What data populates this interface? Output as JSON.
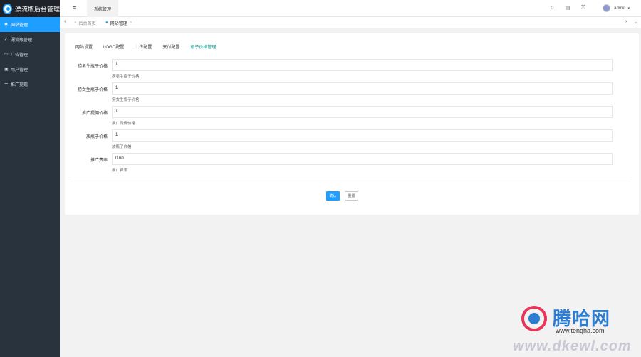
{
  "app": {
    "title": "漂流瓶后台管理"
  },
  "sidebar": {
    "items": [
      {
        "label": "网站管理",
        "icon": "gear-icon",
        "glyph": "✱"
      },
      {
        "label": "漂流瓶管理",
        "icon": "bottle-icon",
        "glyph": "✓"
      },
      {
        "label": "广告管理",
        "icon": "ad-icon",
        "glyph": "▭"
      },
      {
        "label": "用户管理",
        "icon": "user-icon",
        "glyph": "▣"
      },
      {
        "label": "推广提现",
        "icon": "list-icon",
        "glyph": "☰"
      }
    ]
  },
  "header": {
    "top_tab": "系统管理",
    "user": "admin"
  },
  "tabs_bar": {
    "home": "后台首页",
    "current": "网站管理"
  },
  "content": {
    "tabs": [
      "网站设置",
      "LOGO配置",
      "上传配置",
      "支付配置",
      "瓶子价格管理"
    ],
    "fields": [
      {
        "label": "捞男生瓶子价格",
        "value": "1",
        "hint": "捞男生瓶子价格"
      },
      {
        "label": "捞女生瓶子价格",
        "value": "1",
        "hint": "捞女生瓶子价格"
      },
      {
        "label": "推广提佣价格",
        "value": "1",
        "hint": "推广提佣价格"
      },
      {
        "label": "放瓶子价格",
        "value": "1",
        "hint": "放瓶子价格"
      },
      {
        "label": "推广费率",
        "value": "0.60",
        "hint": "推广费率"
      }
    ],
    "ok_label": "确认",
    "reset_label": "重置"
  },
  "watermark": {
    "title": "腾哈网",
    "url1": "www.tengha.com",
    "url2": "www.dkewl.com"
  }
}
